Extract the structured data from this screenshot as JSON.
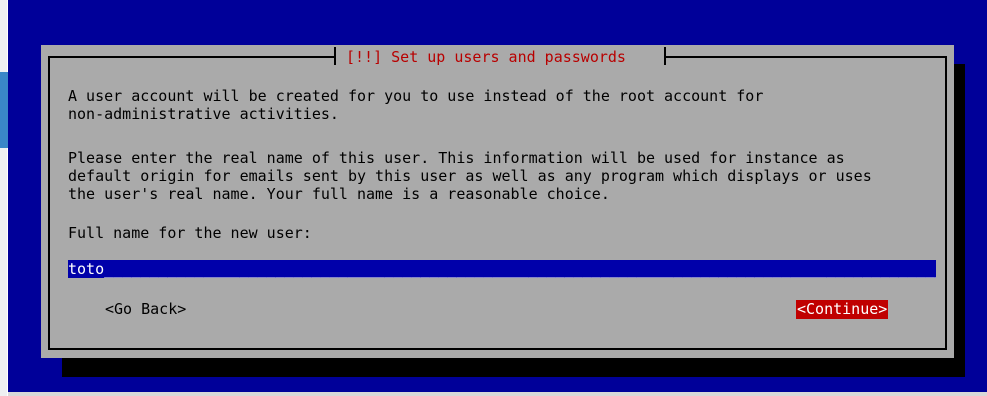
{
  "dialog": {
    "title": "[!!] Set up users and passwords",
    "paragraph1": [
      "A user account will be created for you to use instead of the root account for",
      "non-administrative activities."
    ],
    "paragraph2": [
      "Please enter the real name of this user. This information will be used for instance as",
      "default origin for emails sent by this user as well as any program which displays or uses",
      "the user's real name. Your full name is a reasonable choice."
    ],
    "prompt_label": "Full name for the new user:",
    "input": {
      "value": "toto",
      "fill": "_______________________________________________________________________________________________"
    },
    "buttons": {
      "back_label": "<Go Back>",
      "continue_label": "<Continue>"
    }
  },
  "colors": {
    "background": "#000099",
    "dialog": "#aaaaaa",
    "title_text": "#b80000",
    "input_bg": "#0000aa",
    "continue_bg": "#c00000"
  }
}
